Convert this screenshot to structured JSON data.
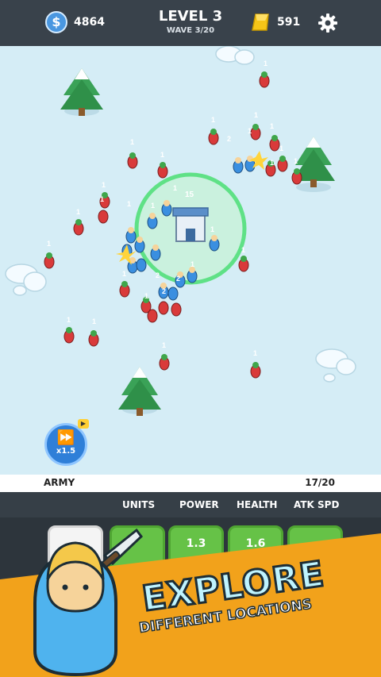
{
  "hud": {
    "coins": "4864",
    "level": "LEVEL 3",
    "wave": "WAVE 3/20",
    "gold": "591",
    "coin_icon": "dollar-coin-icon",
    "gold_icon": "gold-bar-icon",
    "settings_icon": "gear-icon"
  },
  "battlefield": {
    "tower_count": "15",
    "unit_labels": [
      "1",
      "1",
      "1",
      "1",
      "1",
      "1",
      "1",
      "1",
      "1",
      "1",
      "1",
      "1",
      "1",
      "1",
      "1",
      "1",
      "1",
      "1",
      "1",
      "1",
      "1",
      "1",
      "1",
      "1",
      "1",
      "1",
      "2",
      "2",
      "2",
      "2"
    ]
  },
  "speed_button": {
    "label": "x1.5"
  },
  "army": {
    "label": "ARMY",
    "count": "17/20"
  },
  "stats": {
    "headers": [
      "UNITS",
      "POWER",
      "HEALTH",
      "ATK SPD"
    ]
  },
  "upgrades": [
    "",
    "",
    "1.3",
    "1.6",
    ""
  ],
  "promo": {
    "title": "EXPLORE",
    "subtitle": "DIFFERENT LOCATIONS"
  },
  "colors": {
    "ally": "#3a8fe0",
    "enemy": "#d93a3a",
    "accent": "#f2a21b",
    "snow": "#d5edf6"
  }
}
